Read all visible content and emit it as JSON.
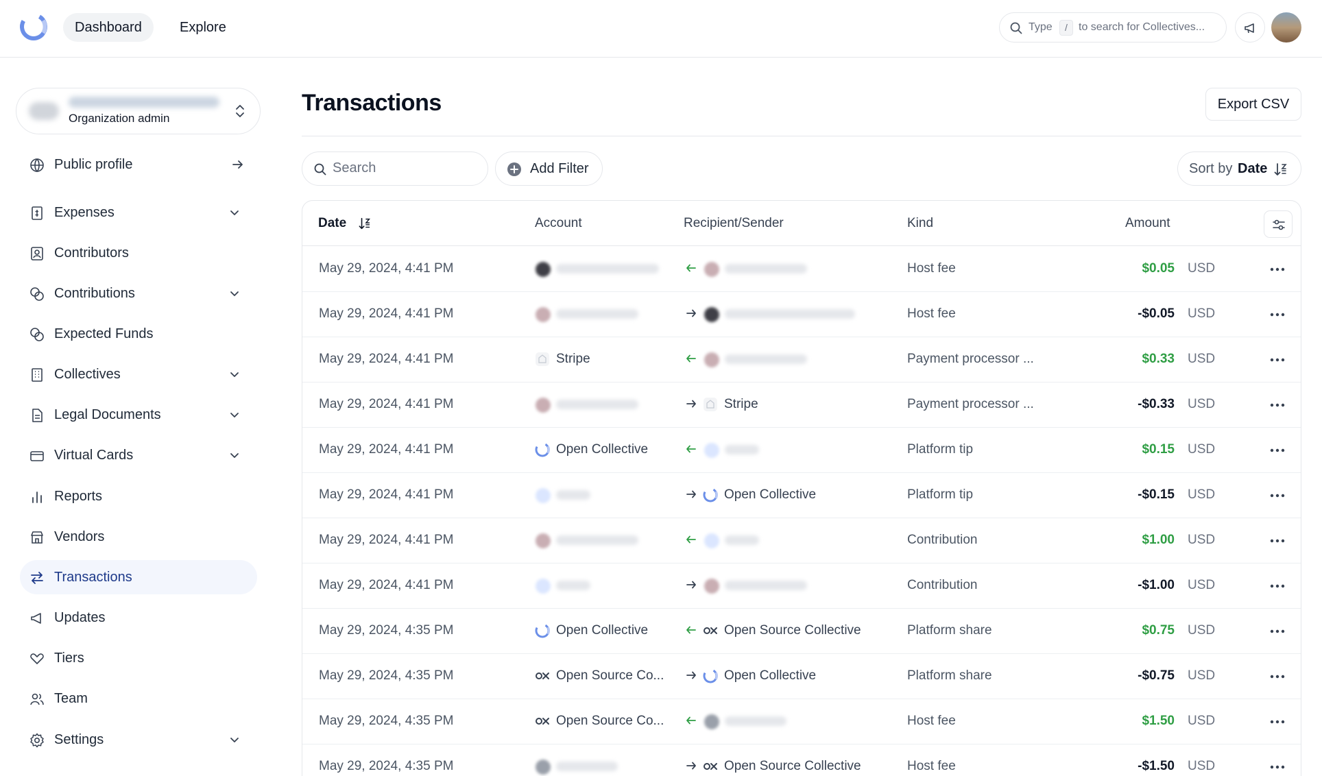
{
  "topbar": {
    "nav": [
      "Dashboard",
      "Explore"
    ],
    "search_placeholder_1": "Type",
    "search_key": "/",
    "search_placeholder_2": "to search for Collectives..."
  },
  "sidebar": {
    "org_role": "Organization admin",
    "items": [
      {
        "label": "Public profile",
        "icon": "globe-icon"
      },
      {
        "label": "Expenses",
        "icon": "receipt-icon"
      },
      {
        "label": "Contributors",
        "icon": "contact-icon"
      },
      {
        "label": "Contributions",
        "icon": "coins-icon"
      },
      {
        "label": "Expected Funds",
        "icon": "coins-icon"
      },
      {
        "label": "Collectives",
        "icon": "building-icon"
      },
      {
        "label": "Legal Documents",
        "icon": "document-icon"
      },
      {
        "label": "Virtual Cards",
        "icon": "credit-card-icon"
      },
      {
        "label": "Reports",
        "icon": "bar-chart-icon"
      },
      {
        "label": "Vendors",
        "icon": "store-icon"
      },
      {
        "label": "Transactions",
        "icon": "arrows-swap-icon"
      },
      {
        "label": "Updates",
        "icon": "megaphone-icon"
      },
      {
        "label": "Tiers",
        "icon": "hand-heart-icon"
      },
      {
        "label": "Team",
        "icon": "users-icon"
      },
      {
        "label": "Settings",
        "icon": "gear-icon"
      }
    ]
  },
  "main": {
    "title": "Transactions",
    "export_label": "Export CSV",
    "search_placeholder": "Search",
    "filter_label": "Add Filter",
    "sort_prefix": "Sort by",
    "sort_field": "Date"
  },
  "table": {
    "headers": [
      "Date",
      "Account",
      "Recipient/Sender",
      "Kind",
      "Amount"
    ],
    "rows": [
      {
        "date": "May 29, 2024, 4:41 PM",
        "account": "",
        "recipient": "",
        "kind": "Host fee",
        "amount": "$0.05",
        "currency": "USD"
      },
      {
        "date": "May 29, 2024, 4:41 PM",
        "account": "",
        "recipient": "",
        "kind": "Host fee",
        "amount": "-$0.05",
        "currency": "USD"
      },
      {
        "date": "May 29, 2024, 4:41 PM",
        "account": "Stripe",
        "recipient": "",
        "kind": "Payment processor ...",
        "amount": "$0.33",
        "currency": "USD"
      },
      {
        "date": "May 29, 2024, 4:41 PM",
        "account": "",
        "recipient": "Stripe",
        "kind": "Payment processor ...",
        "amount": "-$0.33",
        "currency": "USD"
      },
      {
        "date": "May 29, 2024, 4:41 PM",
        "account": "Open Collective",
        "recipient": "",
        "kind": "Platform tip",
        "amount": "$0.15",
        "currency": "USD"
      },
      {
        "date": "May 29, 2024, 4:41 PM",
        "account": "",
        "recipient": "Open Collective",
        "kind": "Platform tip",
        "amount": "-$0.15",
        "currency": "USD"
      },
      {
        "date": "May 29, 2024, 4:41 PM",
        "account": "",
        "recipient": "",
        "kind": "Contribution",
        "amount": "$1.00",
        "currency": "USD"
      },
      {
        "date": "May 29, 2024, 4:41 PM",
        "account": "",
        "recipient": "",
        "kind": "Contribution",
        "amount": "-$1.00",
        "currency": "USD"
      },
      {
        "date": "May 29, 2024, 4:35 PM",
        "account": "Open Collective",
        "recipient": "Open Source Collective",
        "kind": "Platform share",
        "amount": "$0.75",
        "currency": "USD"
      },
      {
        "date": "May 29, 2024, 4:35 PM",
        "account": "Open Source Co...",
        "recipient": "Open Collective",
        "kind": "Platform share",
        "amount": "-$0.75",
        "currency": "USD"
      },
      {
        "date": "May 29, 2024, 4:35 PM",
        "account": "Open Source Co...",
        "recipient": "",
        "kind": "Host fee",
        "amount": "$1.50",
        "currency": "USD"
      },
      {
        "date": "May 29, 2024, 4:35 PM",
        "account": "",
        "recipient": "Open Source Collective",
        "kind": "Host fee",
        "amount": "-$1.50",
        "currency": "USD"
      }
    ]
  },
  "colors": {
    "positive": "#2f9e44",
    "negative": "#111827",
    "active_nav": "#1e3a8a",
    "active_bg": "#f3f6fd"
  }
}
